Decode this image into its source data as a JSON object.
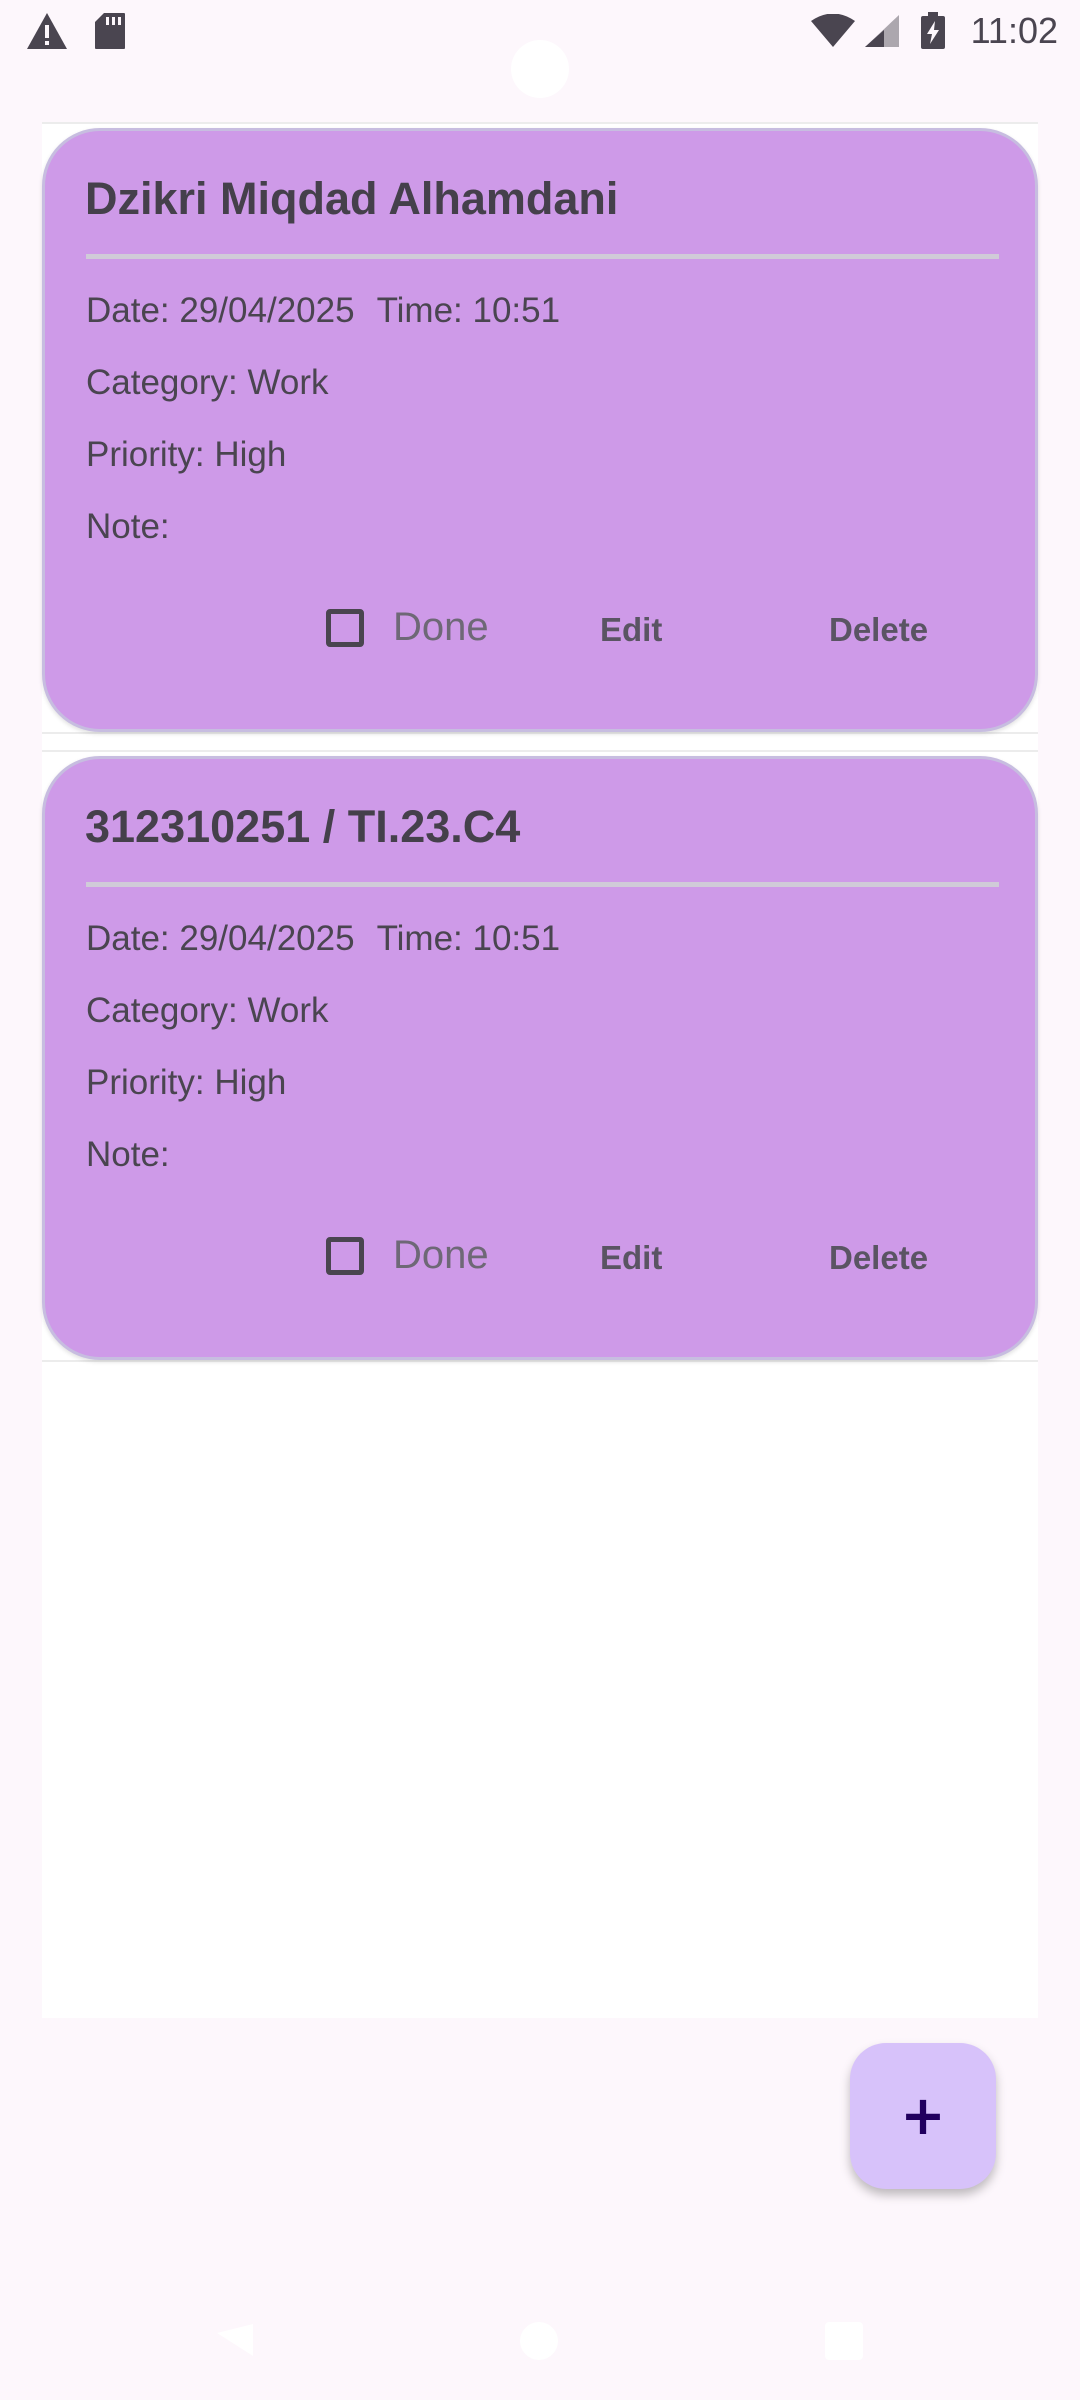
{
  "status_bar": {
    "time": "11:02",
    "left_icons": [
      "warning-icon",
      "sd-card-icon"
    ],
    "right_icons": [
      "wifi-icon",
      "cell-signal-icon",
      "battery-charging-icon"
    ]
  },
  "tasks": [
    {
      "title": "Dzikri Miqdad Alhamdani",
      "date": "Date: 29/04/2025",
      "time": "Time: 10:51",
      "category": "Category: Work",
      "priority": "Priority: High",
      "note": "Note:",
      "done_label": "Done",
      "done_checked": false,
      "edit_label": "Edit",
      "delete_label": "Delete"
    },
    {
      "title": "312310251 / TI.23.C4",
      "date": "Date: 29/04/2025",
      "time": "Time: 10:51",
      "category": "Category: Work",
      "priority": "Priority: High",
      "note": "Note:",
      "done_label": "Done",
      "done_checked": false,
      "edit_label": "Edit",
      "delete_label": "Delete"
    }
  ],
  "fab": {
    "label": "+",
    "icon": "plus-icon"
  },
  "nav_bar": {
    "icons": [
      "back-icon",
      "home-icon",
      "recents-icon"
    ]
  },
  "colors": {
    "card_background": "#ce9ae8",
    "fab_background": "#d7c2fa",
    "fab_icon": "#21005e",
    "page_background": "#fdf7fc"
  }
}
